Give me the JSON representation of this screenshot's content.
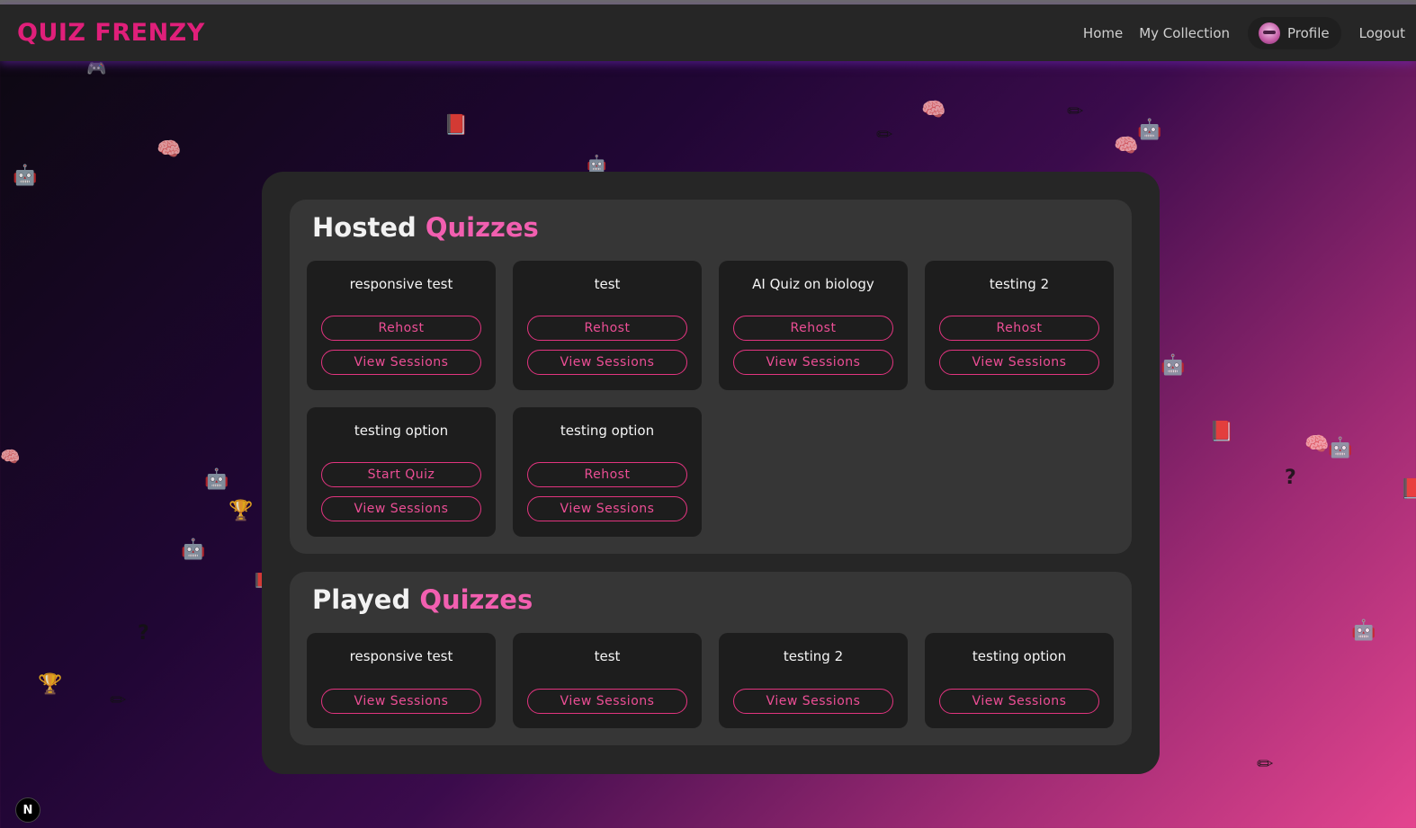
{
  "app": {
    "logo": "QUIZ FRENZY"
  },
  "nav": {
    "home": "Home",
    "collection": "My Collection",
    "profile": "Profile",
    "logout": "Logout"
  },
  "hosted": {
    "title": "Hosted",
    "title_accent": "Quizzes",
    "cards": [
      {
        "title": "responsive test",
        "primary": "Rehost",
        "secondary": "View Sessions"
      },
      {
        "title": "test",
        "primary": "Rehost",
        "secondary": "View Sessions"
      },
      {
        "title": "AI Quiz on biology",
        "primary": "Rehost",
        "secondary": "View Sessions"
      },
      {
        "title": "testing 2",
        "primary": "Rehost",
        "secondary": "View Sessions"
      },
      {
        "title": "testing option",
        "primary": "Start Quiz",
        "secondary": "View Sessions"
      },
      {
        "title": "testing option",
        "primary": "Rehost",
        "secondary": "View Sessions"
      }
    ]
  },
  "played": {
    "title": "Played",
    "title_accent": "Quizzes",
    "cards": [
      {
        "title": "responsive test",
        "secondary": "View Sessions"
      },
      {
        "title": "test",
        "secondary": "View Sessions"
      },
      {
        "title": "testing 2",
        "secondary": "View Sessions"
      },
      {
        "title": "testing option",
        "secondary": "View Sessions"
      }
    ]
  },
  "badge": "N",
  "colors": {
    "brand": "#e01f7a",
    "accent": "#f25fb0",
    "button_border": "#e2347f"
  }
}
